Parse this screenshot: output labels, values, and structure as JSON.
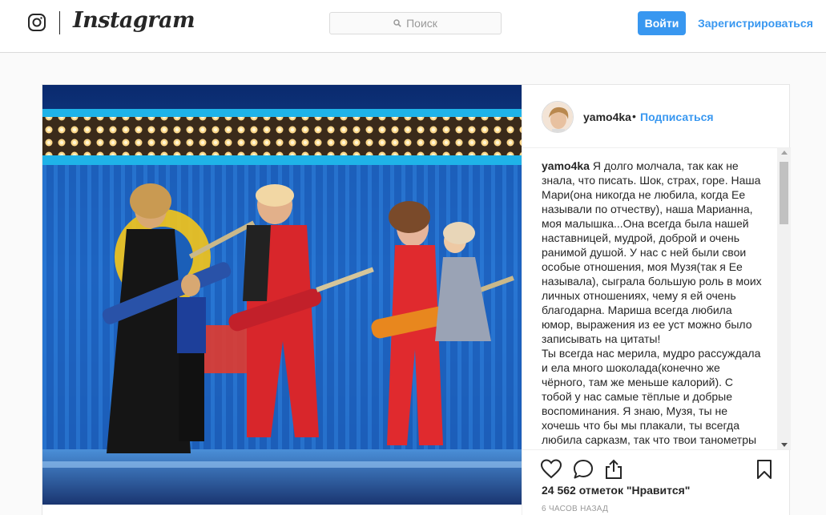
{
  "header": {
    "logo_text": "Instagram",
    "search_placeholder": "Поиск",
    "login_label": "Войти",
    "register_label": "Зарегистрироваться"
  },
  "post": {
    "author": "yamo4ka",
    "separator": "•",
    "follow_label": "Подписаться",
    "caption_author": "yamo4ka",
    "caption_text": "Я долго молчала, так как не знала, что писать. Шок, страх, горе. Наша Мари(она никогда не любила, когда Ее называли по отчеству), наша Марианна, моя малышка...Она всегда была нашей наставницей, мудрой, доброй и очень ранимой душой. У нас с ней были свои особые отношения, моя Музя(так я Ее называла), сыграла большую роль в моих личных отношениях, чему я ей очень благодарна. Мариша всегда любила юмор, выражения из ее уст можно было записывать на цитаты!",
    "caption_text_2": "Ты всегда нас мерила, мудро рассуждала и ела много шоколада(конечно же чёрного, там же меньше калорий). С тобой у нас самые тёплые и добрые воспоминания. Я знаю, Музя, ты не хочешь что бы мы плакали, ты всегда любила сарказм, так что твои танометры",
    "likes": "24 562 отметок \"Нравится\"",
    "time": "6 часов назад"
  },
  "icons": {
    "logo": "instagram-camera-icon",
    "search": "search-icon",
    "like": "heart-icon",
    "comment": "comment-icon",
    "share": "share-icon",
    "save": "bookmark-icon"
  },
  "colors": {
    "accent": "#3897f0",
    "text": "#262626",
    "muted": "#999999",
    "border": "#dbdbdb",
    "background": "#fafafa"
  }
}
